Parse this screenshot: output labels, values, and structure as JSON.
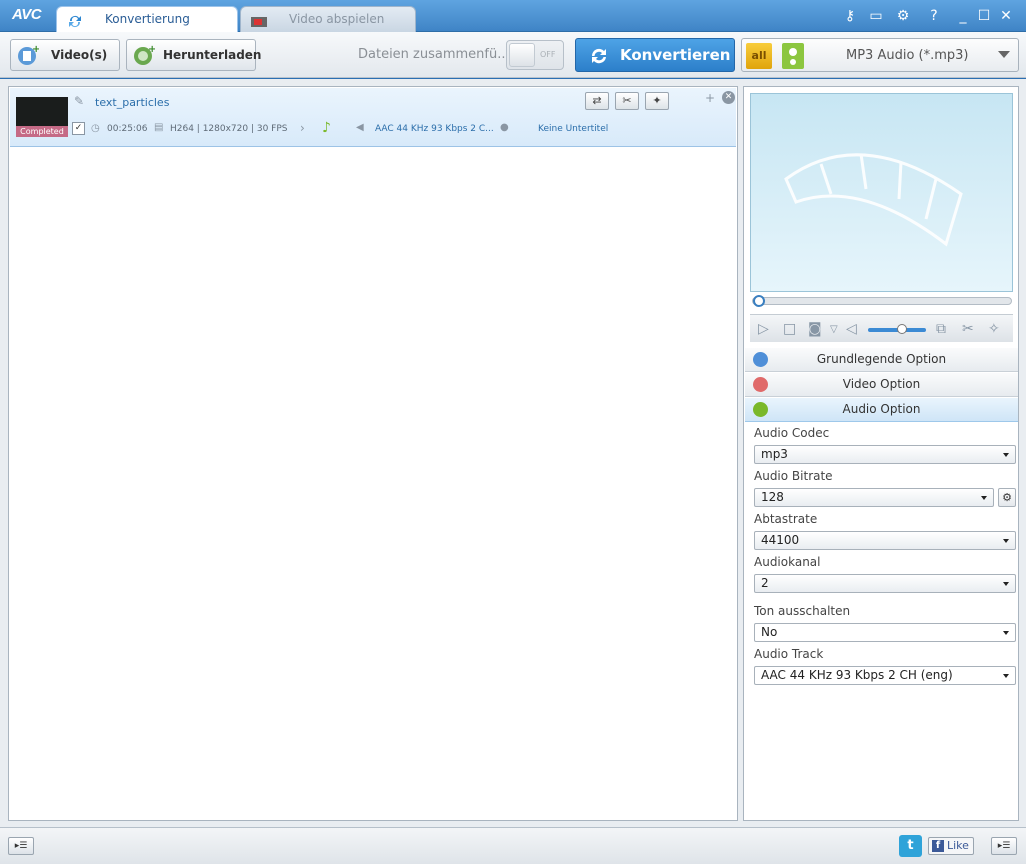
{
  "app": {
    "logo": "AVC"
  },
  "tabs": [
    {
      "label": "Konvertierung",
      "active": true
    },
    {
      "label": "Video abspielen",
      "active": false
    }
  ],
  "toolbar": {
    "add_video_label": "Video(s)",
    "download_label": "Herunterladen",
    "merge_label": "Dateien zusammenfü...",
    "merge_toggle": "OFF",
    "convert_label": "Konvertieren",
    "format_all": "all",
    "format_label": "MP3 Audio (*.mp3)"
  },
  "file": {
    "name": "text_particles",
    "status": "Completed",
    "duration": "00:25:06",
    "video_info": "H264 | 1280x720 | 30 FPS",
    "audio_info": "AAC 44 KHz 93 Kbps 2 C...",
    "subtitle": "Keine Untertitel"
  },
  "options": {
    "basic": "Grundlegende Option",
    "video": "Video Option",
    "audio": "Audio Option",
    "fields": {
      "codec_label": "Audio Codec",
      "codec_value": "mp3",
      "bitrate_label": "Audio Bitrate",
      "bitrate_value": "128",
      "samplerate_label": "Abtastrate",
      "samplerate_value": "44100",
      "channel_label": "Audiokanal",
      "channel_value": "2",
      "mute_label": "Ton ausschalten",
      "mute_value": "No",
      "track_label": "Audio Track",
      "track_value": "AAC 44 KHz 93 Kbps 2 CH (eng)"
    }
  },
  "statusbar": {
    "twitter": "t",
    "like_label": "Like"
  },
  "colors": {
    "accent": "#2c7fca",
    "titlebar": "#4a8fd0",
    "completed_badge": "#c56a86"
  }
}
